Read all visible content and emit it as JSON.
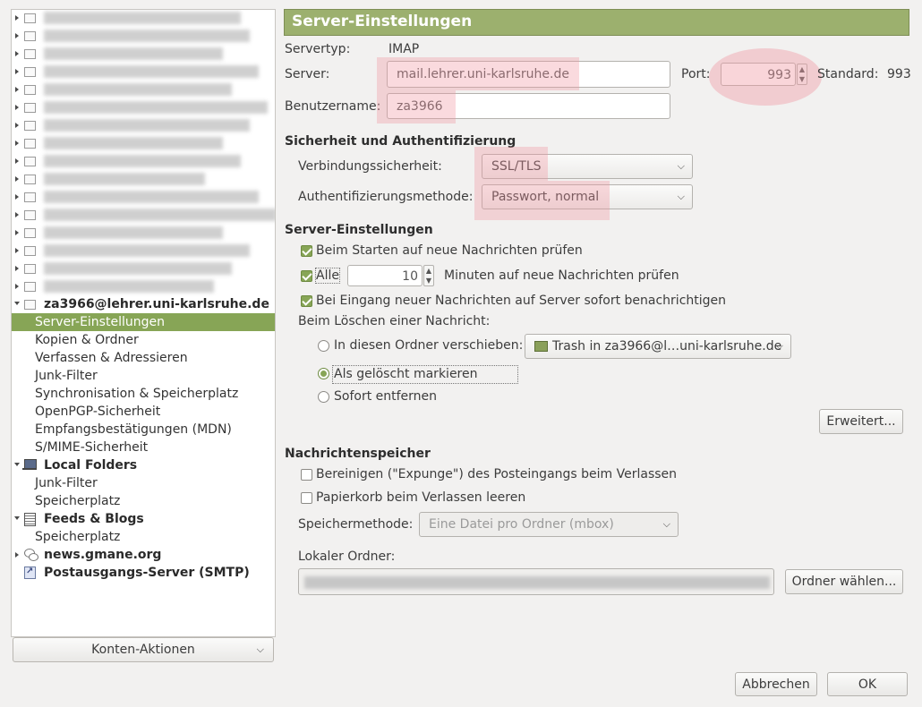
{
  "sidebar": {
    "account": "za3966@lehrer.uni-karlsruhe.de",
    "account_items": [
      {
        "label": "Server-Einstellungen",
        "selected": true
      },
      {
        "label": "Kopien & Ordner"
      },
      {
        "label": "Verfassen & Adressieren"
      },
      {
        "label": "Junk-Filter"
      },
      {
        "label": "Synchronisation & Speicherplatz"
      },
      {
        "label": "OpenPGP-Sicherheit"
      },
      {
        "label": "Empfangsbestätigungen (MDN)"
      },
      {
        "label": "S/MIME-Sicherheit"
      }
    ],
    "local_folders": {
      "label": "Local Folders",
      "items": [
        "Junk-Filter",
        "Speicherplatz"
      ]
    },
    "feeds": {
      "label": "Feeds & Blogs",
      "items": [
        "Speicherplatz"
      ]
    },
    "news": "news.gmane.org",
    "smtp": "Postausgangs-Server (SMTP)",
    "konten_button": "Konten-Aktionen"
  },
  "header": {
    "title": "Server-Einstellungen"
  },
  "server": {
    "type_label": "Servertyp:",
    "type_value": "IMAP",
    "server_label": "Server:",
    "server_value": "mail.lehrer.uni-karlsruhe.de",
    "port_label": "Port:",
    "port_value": "993",
    "standard_label": "Standard:",
    "standard_value": "993",
    "user_label": "Benutzername:",
    "user_value": "za3966"
  },
  "security": {
    "heading": "Sicherheit und Authentifizierung",
    "conn_label": "Verbindungssicherheit:",
    "conn_value": "SSL/TLS",
    "auth_label": "Authentifizierungsmethode:",
    "auth_value": "Passwort, normal"
  },
  "settings": {
    "heading": "Server-Einstellungen",
    "check_startup": "Beim Starten auf neue Nachrichten prüfen",
    "check_every_label": "Alle",
    "check_every_value": "10",
    "check_every_suffix": "Minuten auf neue Nachrichten prüfen",
    "notify": "Bei Eingang neuer Nachrichten auf Server sofort benachrichtigen",
    "delete_label": "Beim Löschen einer Nachricht:",
    "move_option": "In diesen Ordner verschieben:",
    "move_folder": "Trash in za3966@l…uni-karlsruhe.de",
    "mark_option": "Als gelöscht markieren",
    "remove_option": "Sofort entfernen",
    "advanced_button": "Erweitert..."
  },
  "storage": {
    "heading": "Nachrichtenspeicher",
    "expunge": "Bereinigen (\"Expunge\") des Posteingangs beim Verlassen",
    "empty_trash": "Papierkorb beim Verlassen leeren",
    "method_label": "Speichermethode:",
    "method_value": "Eine Datei pro Ordner (mbox)",
    "local_folder_label": "Lokaler Ordner:",
    "choose_folder_button": "Ordner wählen..."
  },
  "footer": {
    "cancel": "Abbrechen",
    "ok": "OK"
  },
  "colors": {
    "accent": "#87a556",
    "header": "#9cb06e",
    "highlight": "#f096a0"
  }
}
